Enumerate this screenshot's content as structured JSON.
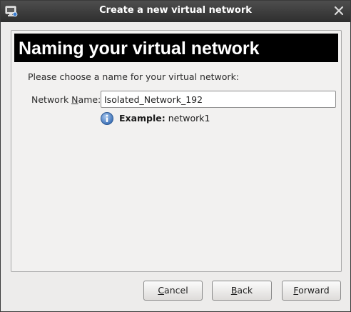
{
  "window": {
    "title": "Create a new virtual network",
    "app_icon": "virt-manager-network-icon",
    "close_icon": "close-icon"
  },
  "header": {
    "title": "Naming your virtual network"
  },
  "form": {
    "prompt": "Please choose a name for your virtual network:",
    "label_pre": "Network ",
    "label_mnemonic": "N",
    "label_post": "ame:",
    "name_value": "Isolated_Network_192",
    "hint_icon": "info-icon",
    "hint_bold": "Example:",
    "hint_text": " network1"
  },
  "buttons": {
    "cancel_mnemonic": "C",
    "cancel_rest": "ancel",
    "back_mnemonic": "B",
    "back_rest": "ack",
    "forward_mnemonic": "F",
    "forward_rest": "orward"
  },
  "colors": {
    "header_bg": "#000000",
    "header_fg": "#ffffff",
    "titlebar_bg": "#3a3a3a",
    "info_icon": "#4a7fc1"
  }
}
